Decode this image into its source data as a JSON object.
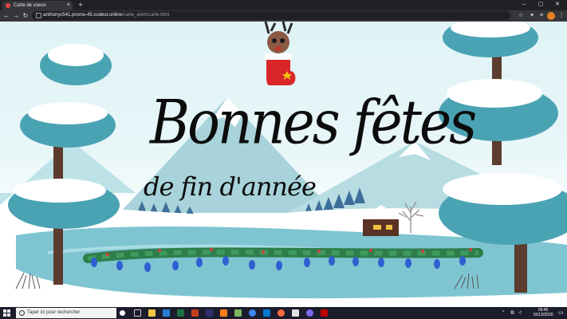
{
  "browser": {
    "tab": {
      "title": "Carte de voeux",
      "close": "×"
    },
    "new_tab": "+",
    "window_controls": {
      "minimize": "–",
      "maximize": "▢",
      "close": "✕"
    },
    "nav": {
      "back": "←",
      "forward": "→",
      "reload": "↻"
    },
    "url": {
      "host": "anthonyc541.promo-45.codeur.online",
      "path": "/carte_anim/carte.html"
    }
  },
  "page": {
    "headline_main": "Bonnes fêtes",
    "headline_sub": "de fin d'année"
  },
  "taskbar": {
    "search_placeholder": "Taper ici pour rechercher",
    "clock_time": "09:45",
    "clock_date": "16/12/2020",
    "colors": {
      "taskbar": "#1b1d2c",
      "accent": "#e8453c"
    }
  }
}
